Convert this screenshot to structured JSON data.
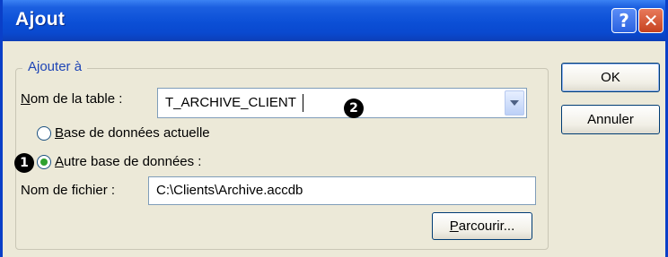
{
  "window": {
    "title": "Ajout",
    "help_glyph": "?",
    "close_glyph": "✕"
  },
  "group": {
    "legend": "Ajouter à"
  },
  "table": {
    "label_accel": "N",
    "label_rest": "om de la table :",
    "value": "T_ARCHIVE_CLIENT"
  },
  "options": {
    "current": {
      "accel": "B",
      "rest": "ase de données actuelle",
      "selected": false
    },
    "other": {
      "accel": "A",
      "rest": "utre base de données :",
      "selected": true
    }
  },
  "file": {
    "label": "Nom de fichier :",
    "value": "C:\\Clients\\Archive.accdb"
  },
  "buttons": {
    "ok": "OK",
    "cancel": "Annuler",
    "browse_accel": "P",
    "browse_rest": "arcourir..."
  },
  "badges": {
    "one": "1",
    "two": "2"
  },
  "colors": {
    "titlebar": "#0b4fd6",
    "dialog": "#ece9d8",
    "legend": "#1e45b6",
    "close": "#c6421f"
  }
}
